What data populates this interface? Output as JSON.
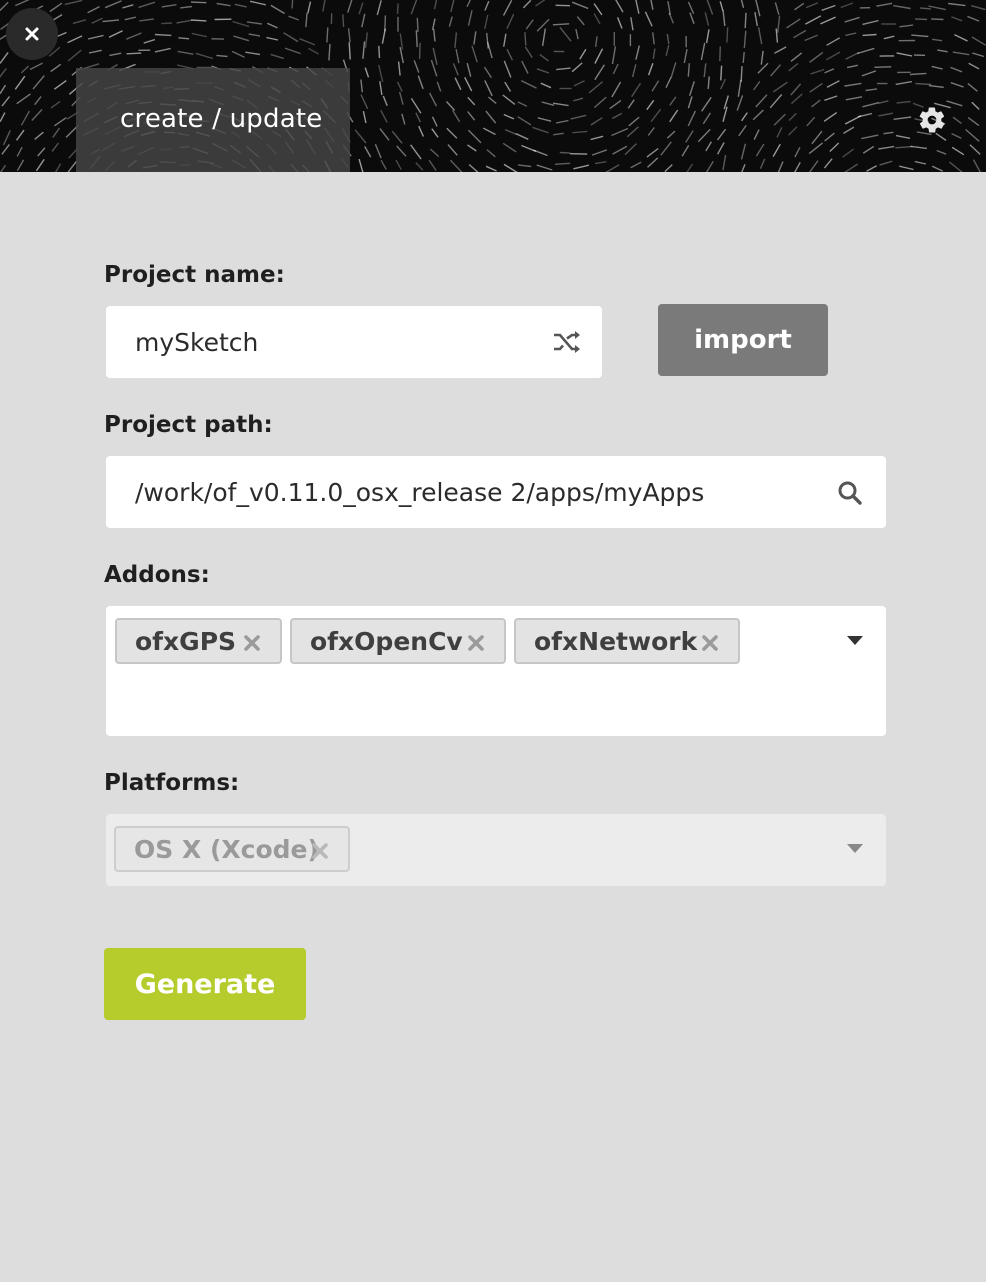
{
  "header": {
    "close_icon": "close-icon",
    "tab_label": "create / update",
    "settings_icon": "gear-icon"
  },
  "form": {
    "project_name": {
      "label": "Project name:",
      "value": "mySketch",
      "icon": "shuffle-icon"
    },
    "import_label": "import",
    "project_path": {
      "label": "Project path:",
      "value": "/work/of_v0.11.0_osx_release 2/apps/myApps",
      "icon": "search-icon"
    },
    "addons": {
      "label": "Addons:",
      "items": [
        "ofxGPS",
        "ofxOpenCv",
        "ofxNetwork"
      ]
    },
    "platforms": {
      "label": "Platforms:",
      "items": [
        "OS X (Xcode)"
      ]
    },
    "generate_label": "Generate"
  },
  "colors": {
    "generate_button": "#b6cc2d",
    "import_button": "#7a7a7a",
    "header_background": "#0b0b0b",
    "page_background": "#dddddd"
  }
}
